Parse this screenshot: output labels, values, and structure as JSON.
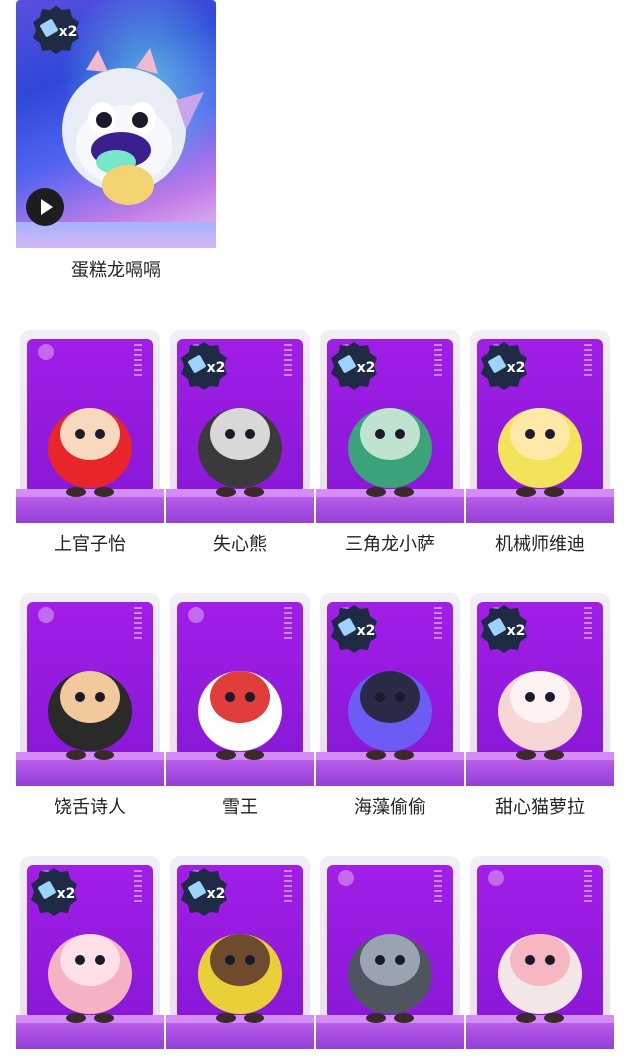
{
  "featured": {
    "name": "蛋糕龙嗝嗝",
    "badge": "x2",
    "play_icon": "play-icon"
  },
  "badge_text": "x2",
  "rows": [
    [
      {
        "name": "上官子怡",
        "badge": false
      },
      {
        "name": "失心熊",
        "badge": true
      },
      {
        "name": "三角龙小萨",
        "badge": true
      },
      {
        "name": "机械师维迪",
        "badge": true
      }
    ],
    [
      {
        "name": "饶舌诗人",
        "badge": false
      },
      {
        "name": "雪王",
        "badge": false
      },
      {
        "name": "海藻偷偷",
        "badge": true
      },
      {
        "name": "甜心猫萝拉",
        "badge": true
      }
    ],
    [
      {
        "name": "",
        "badge": true
      },
      {
        "name": "",
        "badge": true
      },
      {
        "name": "",
        "badge": false
      },
      {
        "name": "",
        "badge": false
      }
    ]
  ],
  "colors": {
    "card_purple": "#9b1fe4",
    "badge_bg": "#1f2a44",
    "badge_text": "#ffffff"
  }
}
